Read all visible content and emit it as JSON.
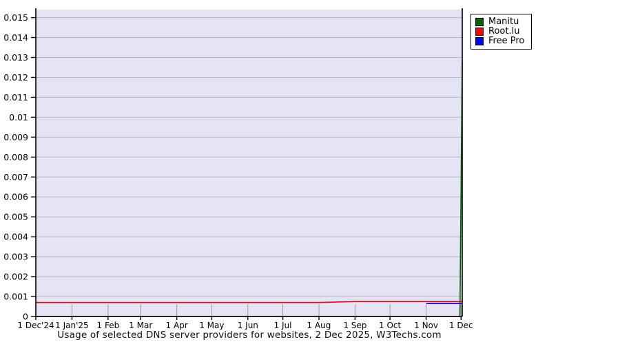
{
  "title": {
    "text": "Usage of selected DNS server providers for websites, 2 Dec 2025, W3Techs.com"
  },
  "legend": {
    "items": [
      {
        "label": "Manitu",
        "color": "#006400",
        "swatch_icon": "green-square-icon"
      },
      {
        "label": "Root.lu",
        "color": "#ff0000",
        "swatch_icon": "red-square-icon"
      },
      {
        "label": "Free Pro",
        "color": "#0000ff",
        "swatch_icon": "blue-square-icon"
      }
    ]
  },
  "chart_data": {
    "type": "line",
    "title": "Usage of selected DNS server providers for websites, 2 Dec 2025, W3Techs.com",
    "xlabel": "",
    "ylabel": "",
    "ylim": [
      0,
      0.0154
    ],
    "x_range_days": [
      0,
      366
    ],
    "grid": "horizontal-full, short-vertical-month-ticks",
    "legend_position": "outside-top-right",
    "colors": {
      "plot_background": "#e4e4f4",
      "hgrid": "#b9b9c4",
      "month_tick_inner": "#9a9aa6",
      "axis": "#000000",
      "text": "#000000"
    },
    "y_ticks": [
      {
        "label": "0",
        "value": 0
      },
      {
        "label": "0.001",
        "value": 0.001
      },
      {
        "label": "0.002",
        "value": 0.002
      },
      {
        "label": "0.003",
        "value": 0.003
      },
      {
        "label": "0.004",
        "value": 0.004
      },
      {
        "label": "0.005",
        "value": 0.005
      },
      {
        "label": "0.006",
        "value": 0.006
      },
      {
        "label": "0.007",
        "value": 0.007
      },
      {
        "label": "0.008",
        "value": 0.008
      },
      {
        "label": "0.009",
        "value": 0.009
      },
      {
        "label": "0.01",
        "value": 0.01
      },
      {
        "label": "0.011",
        "value": 0.011
      },
      {
        "label": "0.012",
        "value": 0.012
      },
      {
        "label": "0.013",
        "value": 0.013
      },
      {
        "label": "0.014",
        "value": 0.014
      },
      {
        "label": "0.015",
        "value": 0.015
      }
    ],
    "x_ticks": [
      {
        "label": "1 Dec'24",
        "day": 0
      },
      {
        "label": "1 Jan'25",
        "day": 31
      },
      {
        "label": "1 Feb",
        "day": 62
      },
      {
        "label": "1 Mar",
        "day": 90
      },
      {
        "label": "1 Apr",
        "day": 121
      },
      {
        "label": "1 May",
        "day": 151
      },
      {
        "label": "1 Jun",
        "day": 182
      },
      {
        "label": "1 Jul",
        "day": 212
      },
      {
        "label": "1 Aug",
        "day": 243
      },
      {
        "label": "1 Sep",
        "day": 274
      },
      {
        "label": "1 Oct",
        "day": 304
      },
      {
        "label": "1 Nov",
        "day": 335
      },
      {
        "label": "1 Dec",
        "day": 365
      }
    ],
    "series": [
      {
        "name": "Manitu",
        "color": "#006400",
        "points": [
          [
            0,
            0
          ],
          [
            364,
            0
          ],
          [
            366,
            0.0128
          ]
        ],
        "note": "near zero all year, vertical spike to 0.0128 at right edge (2 Dec 2025)"
      },
      {
        "name": "Root.lu",
        "color": "#ff0000",
        "points": [
          [
            0,
            0.0007
          ],
          [
            243,
            0.0007
          ],
          [
            274,
            0.00075
          ],
          [
            366,
            0.00075
          ]
        ],
        "note": "flat ~0.0007, slight rise to ~0.00075 between 1 Aug and 1 Sep"
      },
      {
        "name": "Free Pro",
        "color": "#0000ff",
        "points": [
          [
            335,
            0.00065
          ],
          [
            366,
            0.00065
          ]
        ],
        "note": "appears 1 Nov 2025 at ~0.00065, flat to end"
      }
    ]
  }
}
